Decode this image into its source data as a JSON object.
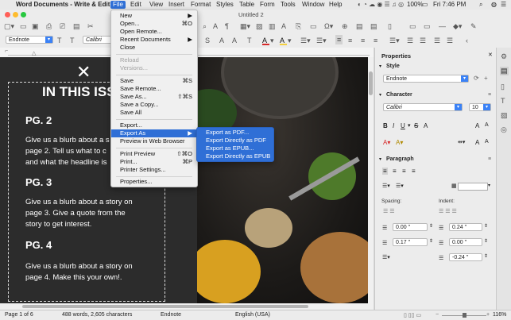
{
  "menubar": {
    "apple": "",
    "app_name": "Word Documents - Write & Edit",
    "items": [
      "File",
      "Edit",
      "View",
      "Insert",
      "Format",
      "Styles",
      "Table",
      "Form",
      "Tools",
      "Window",
      "Help"
    ],
    "battery": "100%",
    "clock": "Fri 7:46 PM"
  },
  "window": {
    "title": "Untitled 2"
  },
  "toolbar": {
    "style_value": "Endnote",
    "font_value": "Calibri"
  },
  "file_menu": {
    "items": [
      {
        "label": "New",
        "shortcut": "",
        "disabled": false,
        "submenu": true
      },
      {
        "label": "Open...",
        "shortcut": "⌘O",
        "disabled": false,
        "submenu": false
      },
      {
        "label": "Open Remote...",
        "shortcut": "",
        "disabled": false,
        "submenu": false
      },
      {
        "label": "Recent Documents",
        "shortcut": "",
        "disabled": false,
        "submenu": true
      },
      {
        "label": "Close",
        "shortcut": "",
        "disabled": false,
        "submenu": false
      },
      {
        "label": "Reload",
        "shortcut": "",
        "disabled": true,
        "submenu": false
      },
      {
        "label": "Versions...",
        "shortcut": "",
        "disabled": true,
        "submenu": false
      },
      {
        "label": "Save",
        "shortcut": "⌘S",
        "disabled": false,
        "submenu": false
      },
      {
        "label": "Save Remote...",
        "shortcut": "",
        "disabled": false,
        "submenu": false
      },
      {
        "label": "Save As...",
        "shortcut": "⇧⌘S",
        "disabled": false,
        "submenu": false
      },
      {
        "label": "Save a Copy...",
        "shortcut": "",
        "disabled": false,
        "submenu": false
      },
      {
        "label": "Save All",
        "shortcut": "",
        "disabled": false,
        "submenu": false
      },
      {
        "label": "Export...",
        "shortcut": "",
        "disabled": false,
        "submenu": false
      },
      {
        "label": "Export As",
        "shortcut": "",
        "disabled": false,
        "submenu": true
      },
      {
        "label": "Preview in Web Browser",
        "shortcut": "",
        "disabled": false,
        "submenu": false
      },
      {
        "label": "Print Preview",
        "shortcut": "⇧⌘O",
        "disabled": false,
        "submenu": false
      },
      {
        "label": "Print...",
        "shortcut": "⌘P",
        "disabled": false,
        "submenu": false
      },
      {
        "label": "Printer Settings...",
        "shortcut": "",
        "disabled": false,
        "submenu": false
      },
      {
        "label": "Properties...",
        "shortcut": "",
        "disabled": false,
        "submenu": false
      }
    ],
    "highlighted": "Export As"
  },
  "export_submenu": {
    "items": [
      "Export as PDF...",
      "Export Directly as PDF",
      "Export as EPUB...",
      "Export Directly as EPUB"
    ]
  },
  "document": {
    "title_partial": "IN THIS ISS",
    "sections": [
      {
        "heading": "PG. 2",
        "lines": [
          "Give us a blurb about a s",
          "page 2.  Tell us what to c",
          "and what the headline is"
        ]
      },
      {
        "heading": "PG. 3",
        "lines": [
          "Give us a blurb about a story on",
          "page 3.  Give a quote from the",
          "story to get interest."
        ]
      },
      {
        "heading": "PG. 4",
        "lines": [
          "Give us a blurb about a story on",
          "page 4.  Make this your own!."
        ]
      }
    ]
  },
  "sidebar": {
    "title": "Properties",
    "style_header": "Style",
    "style_value": "Endnote",
    "character_header": "Character",
    "font_value": "Calibri",
    "font_size": "10",
    "paragraph_header": "Paragraph",
    "spacing_label": "Spacing:",
    "indent_label": "Indent:",
    "spacing_above": "0.00 \"",
    "spacing_below": "0.17 \"",
    "indent_before": "0.24 \"",
    "indent_after": "0.00 \"",
    "indent_first": "-0.24 \""
  },
  "statusbar": {
    "page": "Page 1 of 6",
    "counts": "488 words, 2,605 characters",
    "style": "Endnote",
    "language": "English (USA)",
    "zoom": "116%"
  },
  "colors": {
    "accent": "#2f6fd6",
    "doc_bg": "#2c2c2c",
    "font_color_red": "#d62828",
    "highlight_yellow": "#f4d03f"
  }
}
